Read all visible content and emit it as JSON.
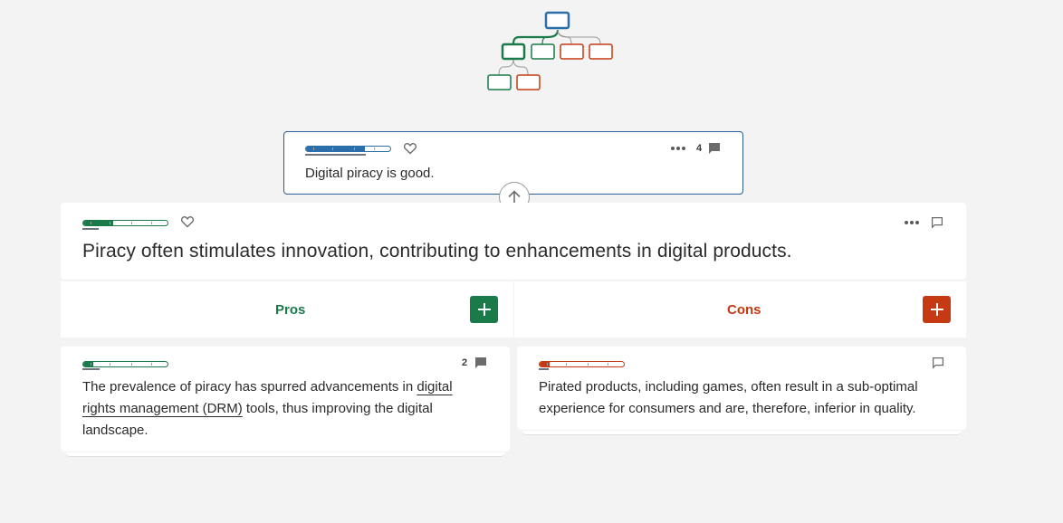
{
  "tree": {
    "colors": {
      "root": "#2a6eaa",
      "pro": "#1a7a4a",
      "con": "#c53a12",
      "connector": "#9a9a9a"
    }
  },
  "parent_claim": {
    "text": "Digital piracy is good.",
    "comment_count": "4",
    "score_color": "#2a6eaa",
    "score_fraction": 0.7
  },
  "main_claim": {
    "text": "Piracy often stimulates innovation, contributing to enhancements in digital products.",
    "score_color": "#1a7a4a",
    "score_fraction": 0.35
  },
  "columns": {
    "pros": {
      "title": "Pros",
      "color": "#1a7a4a"
    },
    "cons": {
      "title": "Cons",
      "color": "#c53a12"
    }
  },
  "pro_argument": {
    "text_before": "The prevalence of piracy has spurred advancements in ",
    "link_text": "digital rights management (DRM)",
    "text_after": " tools, thus improving the digital landscape.",
    "comment_count": "2",
    "score_color": "#1a7a4a",
    "score_fraction": 0.12
  },
  "con_argument": {
    "text": "Pirated products, including games, often result in a sub-optimal experience for consumers and are, therefore, inferior in quality.",
    "score_color": "#c53a12",
    "score_fraction": 0.12
  },
  "icons": {
    "heart": "heart-icon",
    "more": "more-dots-icon",
    "comment": "comment-icon",
    "up": "arrow-up-icon",
    "add": "plus-icon"
  }
}
